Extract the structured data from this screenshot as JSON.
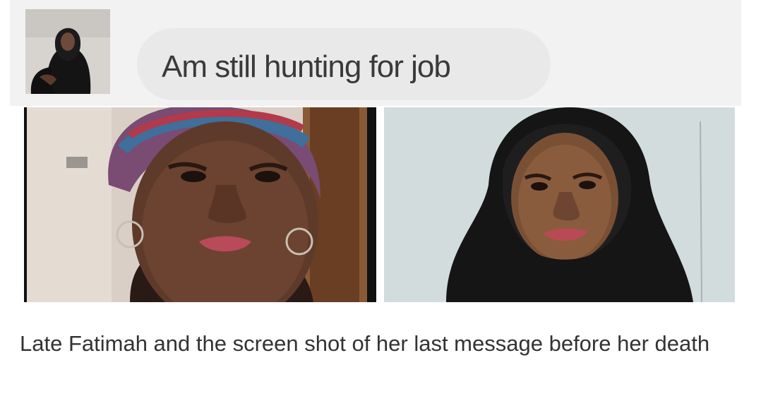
{
  "message": {
    "text": "Am still hunting for job"
  },
  "caption": {
    "text": "Late Fatimah and the screen shot of her last message before her death"
  },
  "colors": {
    "page_background": "#ffffff",
    "panel_background": "#f2f2f2",
    "bubble_background": "#e9e9ea",
    "message_text": "#3a3a3a",
    "caption_text": "#333333"
  }
}
